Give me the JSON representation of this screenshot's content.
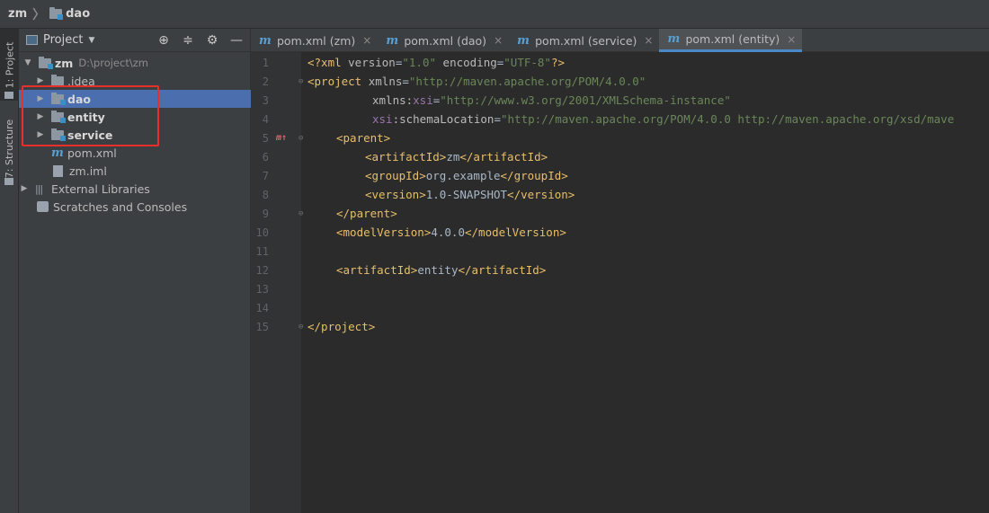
{
  "breadcrumb": {
    "root": "zm",
    "current": "dao"
  },
  "toolstrip": {
    "project_tab": "1: Project",
    "structure_tab": "7: Structure"
  },
  "project_panel": {
    "title": "Project",
    "tree": {
      "root": {
        "name": "zm",
        "path": "D:\\project\\zm"
      },
      "idea": ".idea",
      "dao": "dao",
      "entity": "entity",
      "service": "service",
      "pom": "pom.xml",
      "iml": "zm.iml",
      "external_libraries": "External Libraries",
      "scratches": "Scratches and Consoles"
    }
  },
  "tabs": [
    {
      "label": "pom.xml (zm)"
    },
    {
      "label": "pom.xml (dao)"
    },
    {
      "label": "pom.xml (service)"
    },
    {
      "label": "pom.xml (entity)",
      "active": true
    }
  ],
  "editor": {
    "line_numbers": [
      "1",
      "2",
      "3",
      "4",
      "5",
      "6",
      "7",
      "8",
      "9",
      "10",
      "11",
      "12",
      "13",
      "14",
      "15"
    ],
    "l1": {
      "open": "<?xml ",
      "a1": "version",
      "eq1": "=",
      "v1": "\"1.0\"",
      "a2": " encoding",
      "eq2": "=",
      "v2": "\"UTF-8\"",
      "close": "?>"
    },
    "l2": {
      "tag": "<project",
      "attr": " xmlns",
      "eq": "=",
      "val": "\"http://maven.apache.org/POM/4.0.0\""
    },
    "l3": {
      "attr": "xmlns:",
      "ns": "xsi",
      "eq": "=",
      "val": "\"http://www.w3.org/2001/XMLSchema-instance\""
    },
    "l4": {
      "ns": "xsi",
      "attr": ":schemaLocation",
      "eq": "=",
      "val": "\"http://maven.apache.org/POM/4.0.0 http://maven.apache.org/xsd/mave"
    },
    "l5": {
      "tag": "<parent>"
    },
    "l6": {
      "open": "<artifactId>",
      "text": "zm",
      "close": "</artifactId>"
    },
    "l7": {
      "open": "<groupId>",
      "text": "org.example",
      "close": "</groupId>"
    },
    "l8": {
      "open": "<version>",
      "text": "1.0-SNAPSHOT",
      "close": "</version>"
    },
    "l9": {
      "tag": "</parent>"
    },
    "l10": {
      "open": "<modelVersion>",
      "text": "4.0.0",
      "close": "</modelVersion>"
    },
    "l12": {
      "open": "<artifactId>",
      "text": "entity",
      "close": "</artifactId>"
    },
    "l15": {
      "tag": "</project>"
    }
  },
  "colors": {
    "selection": "#4b6eaf",
    "highlight_box": "#e8302a",
    "tab_underline": "#4a88c7"
  }
}
